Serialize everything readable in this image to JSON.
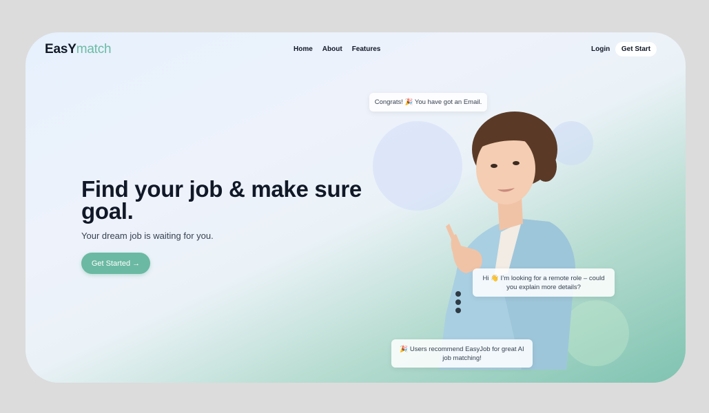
{
  "brand": {
    "name_main": "EasY",
    "name_accent": "match"
  },
  "nav": {
    "items": [
      {
        "label": "Home"
      },
      {
        "label": "About"
      },
      {
        "label": "Features"
      }
    ]
  },
  "header_actions": {
    "login_label": "Login",
    "get_start_label": "Get Start"
  },
  "hero": {
    "title": "Find your job & make sure goal.",
    "subtitle": "Your dream job is waiting for you.",
    "cta_label": "Get Started →"
  },
  "bubbles": {
    "congrats": "Congrats! 🎉 You have got an Email.",
    "remote": "Hi 👋 I’m looking for a remote role – could you explain more details?",
    "recommend": "🎉 Users recommend EasyJob for great AI job matching!"
  },
  "colors": {
    "accent": "#6bb9a2",
    "text_dark": "#111827",
    "background": "#dcdcdc"
  }
}
